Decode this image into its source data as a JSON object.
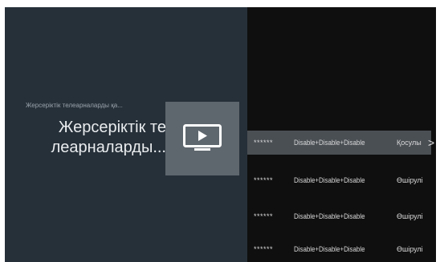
{
  "header": {
    "breadcrumb": "Жерсеріктік телеарналарды қа...",
    "title_line1": "Жерсеріктік те",
    "title_line2": "леарналарды..."
  },
  "icon": {
    "name": "play-icon"
  },
  "rows": [
    {
      "col1": "******",
      "col2": "Disable+Disable+Disable",
      "col3": "Қосулы",
      "chevron": ">",
      "selected": true
    },
    {
      "col1": "******",
      "col2": "Disable+Disable+Disable",
      "col3": "Өшірулі",
      "selected": false
    },
    {
      "col1": "******",
      "col2": "Disable+Disable+Disable",
      "col3": "Өшірулі",
      "selected": false
    },
    {
      "col1": "******",
      "col2": "Disable+Disable+Disable",
      "col3": "Өшірулі",
      "selected": false
    }
  ],
  "colors": {
    "left_panel": "#263039",
    "right_panel": "#0f0f0f",
    "selected_row": "#4a4f54",
    "icon_tile": "#5f676e"
  }
}
